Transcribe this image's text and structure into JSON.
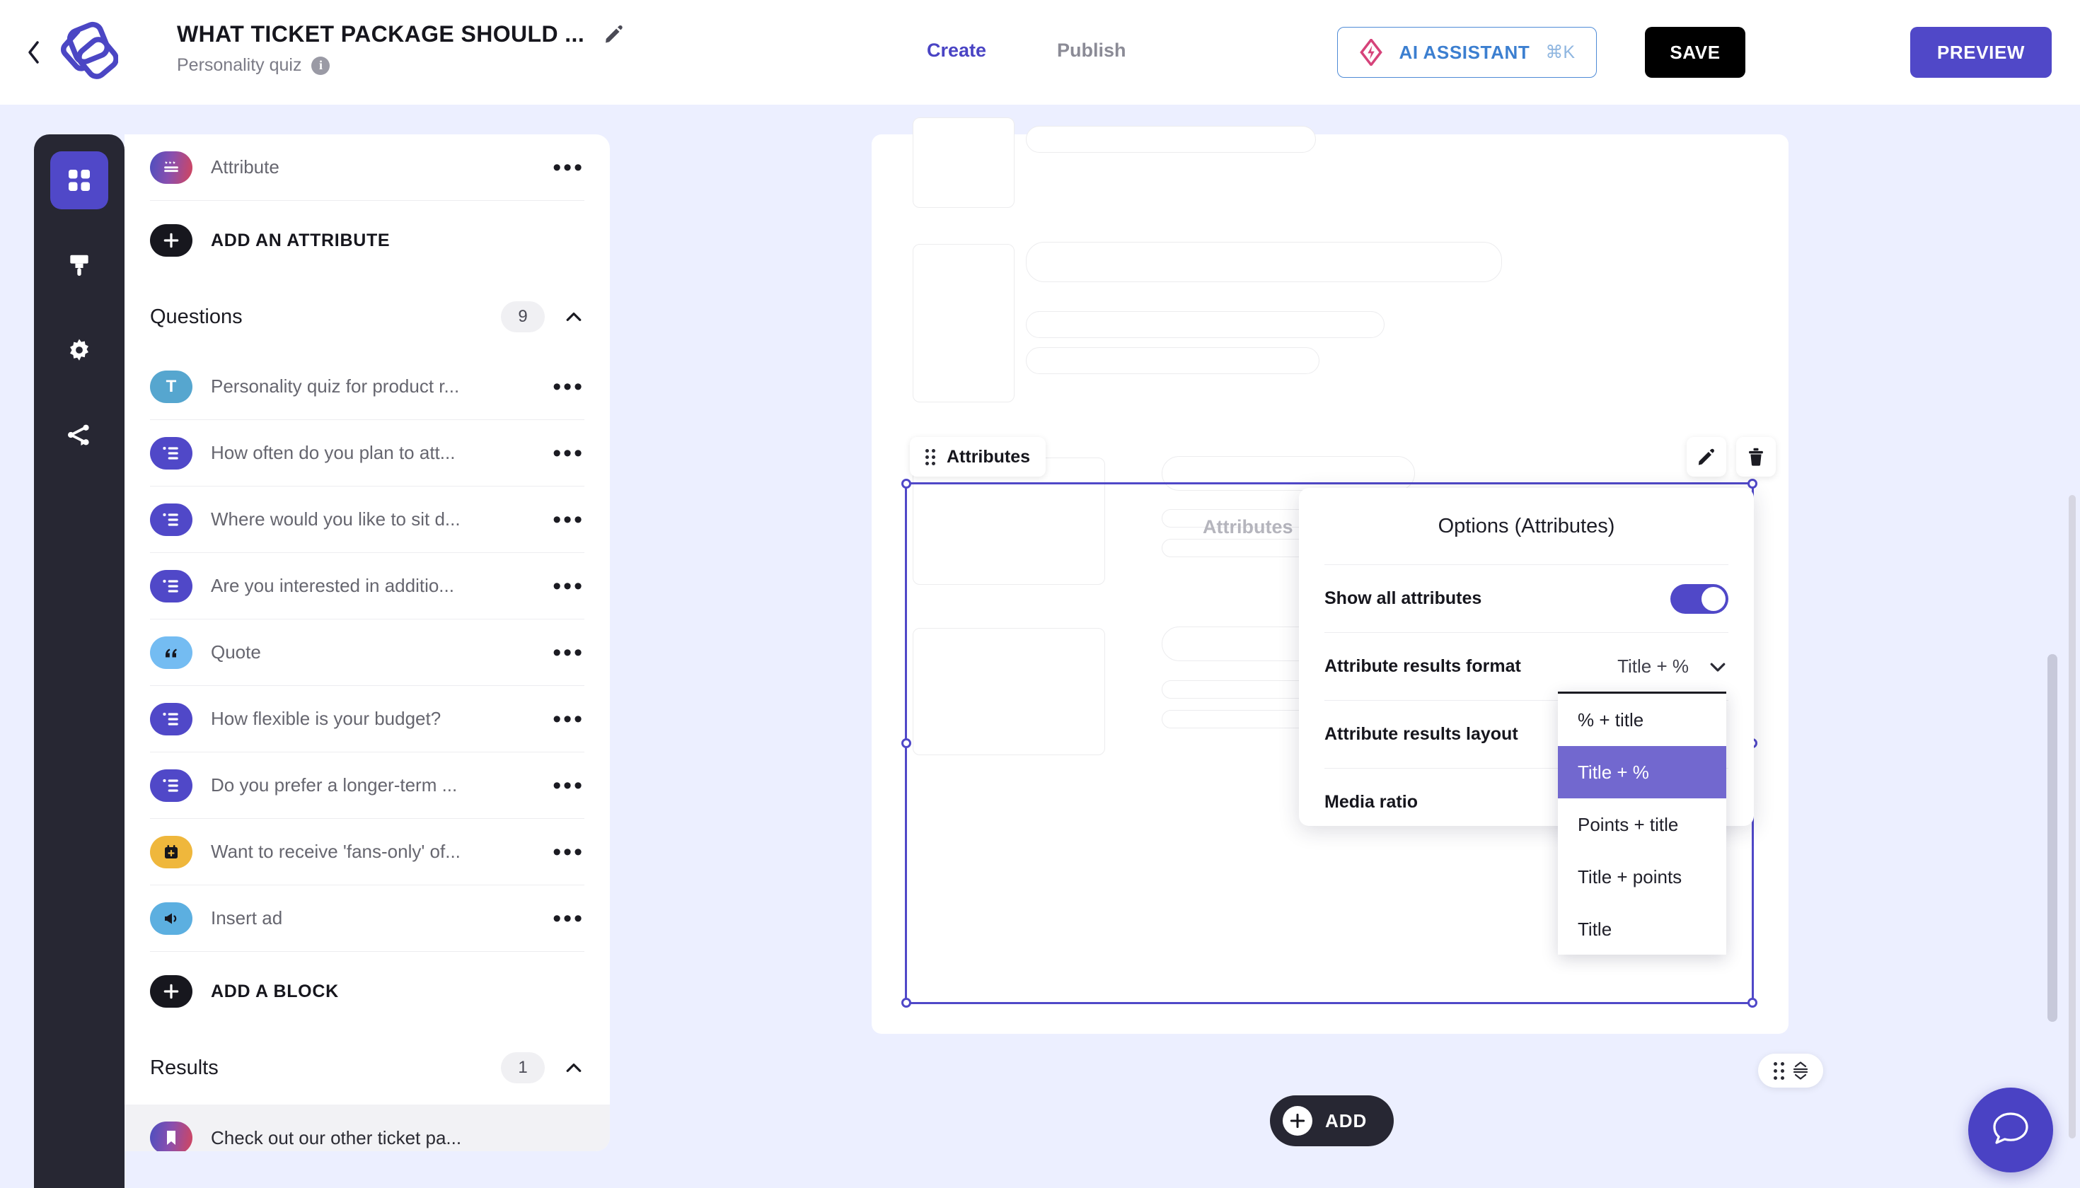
{
  "header": {
    "back_icon": "chevron-left-icon",
    "logo_icon": "brand-logo-icon",
    "title": "WHAT TICKET PACKAGE SHOULD ...",
    "edit_icon": "pencil-icon",
    "subtitle": "Personality quiz",
    "info_icon": "info-icon",
    "info_glyph": "i",
    "tabs": [
      {
        "label": "Create",
        "active": true
      },
      {
        "label": "Publish",
        "active": false
      }
    ],
    "ai_button": {
      "label": "AI ASSISTANT",
      "shortcut": "⌘K",
      "icon": "ai-sparkle-icon"
    },
    "save_label": "SAVE",
    "preview_label": "PREVIEW",
    "accent_color": "#5048c8",
    "ai_border_color": "#4f8bd6"
  },
  "rail": {
    "items": [
      {
        "icon": "grid-blocks-icon",
        "name": "blocks",
        "active": true
      },
      {
        "icon": "paint-brush-icon",
        "name": "design",
        "active": false
      },
      {
        "icon": "gear-icon",
        "name": "settings",
        "active": false
      },
      {
        "icon": "share-nodes-icon",
        "name": "share",
        "active": false
      }
    ]
  },
  "sidebar": {
    "attribute_row": {
      "label": "Attribute",
      "chip": "attribute-icon",
      "menu": "•••"
    },
    "add_attribute_label": "ADD AN ATTRIBUTE",
    "questions_section": {
      "label": "Questions",
      "count": "9",
      "collapse_icon": "chevron-up-icon"
    },
    "questions": [
      {
        "label": "Personality quiz for product r...",
        "chip": "text-icon",
        "glyph": "T"
      },
      {
        "label": "How often do you plan to att...",
        "chip": "choice-icon",
        "glyph": ""
      },
      {
        "label": "Where would you like to sit d...",
        "chip": "choice-icon",
        "glyph": ""
      },
      {
        "label": "Are you interested in additio...",
        "chip": "choice-icon",
        "glyph": ""
      },
      {
        "label": "Quote",
        "chip": "quote-icon",
        "glyph": "“"
      },
      {
        "label": "How flexible is your budget?",
        "chip": "choice-icon",
        "glyph": ""
      },
      {
        "label": "Do you prefer a longer-term ...",
        "chip": "choice-icon",
        "glyph": ""
      },
      {
        "label": "Want to receive 'fans-only' of...",
        "chip": "calendar-icon",
        "glyph": ""
      },
      {
        "label": "Insert ad",
        "chip": "megaphone-icon",
        "glyph": ""
      }
    ],
    "add_block_label": "ADD A BLOCK",
    "results_section": {
      "label": "Results",
      "count": "1",
      "collapse_icon": "chevron-up-icon"
    },
    "results": [
      {
        "label": "Check out our other ticket pa...",
        "chip": "bookmark-icon",
        "selected": true
      }
    ]
  },
  "canvas": {
    "block_label": "Attributes",
    "block_grip_icon": "drag-grip-icon",
    "edit_icon": "pencil-icon",
    "delete_icon": "trash-icon",
    "attributes_heading": "Attributes",
    "add_button_label": "ADD",
    "mini_toolbar": {
      "grip_icon": "drag-grip-icon",
      "resize_icon": "resize-vertical-icon"
    },
    "chat_icon": "chat-bubble-icon"
  },
  "options_panel": {
    "title": "Options (Attributes)",
    "rows": [
      {
        "label": "Show all attributes",
        "control": "toggle",
        "value": "on"
      },
      {
        "label": "Attribute results format",
        "control": "select",
        "value": "Title + %",
        "chevron": "chevron-down-icon"
      },
      {
        "label": "Attribute results layout",
        "control": "select",
        "value": ""
      },
      {
        "label": "Media ratio",
        "control": "select",
        "value": ""
      }
    ]
  },
  "dropdown": {
    "options": [
      {
        "label": "% + title",
        "selected": false
      },
      {
        "label": "Title + %",
        "selected": true
      },
      {
        "label": "Points + title",
        "selected": false
      },
      {
        "label": "Title + points",
        "selected": false
      },
      {
        "label": "Title",
        "selected": false
      }
    ],
    "highlight_color": "#7268cf"
  }
}
